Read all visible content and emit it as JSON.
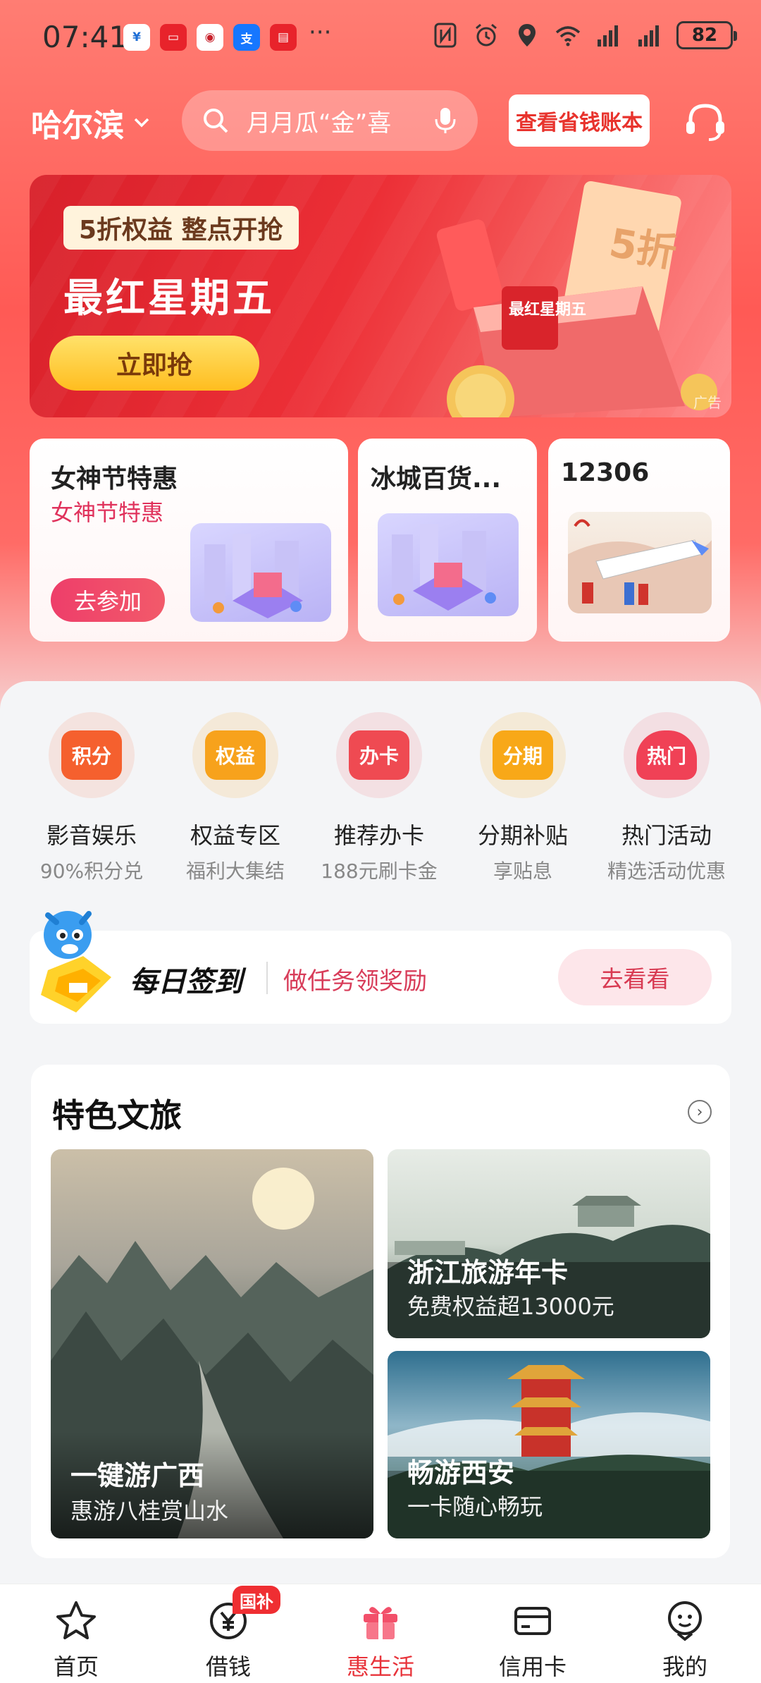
{
  "status_bar": {
    "time": "07:41",
    "battery": "82",
    "more": "···"
  },
  "header": {
    "city": "哈尔滨",
    "search_placeholder": "月月瓜“金”喜",
    "save_button": "查看省钱账本"
  },
  "banner": {
    "tag": "5折权益 整点开抢",
    "title": "最红星期五",
    "button": "立即抢",
    "ad_label": "广告",
    "art_ticket": "5折",
    "art_box": "最红星期五"
  },
  "promos": [
    {
      "title": "女神节特惠",
      "subtitle": "女神节特惠",
      "button": "去参加"
    },
    {
      "title": "冰城百货..."
    },
    {
      "title": "12306"
    }
  ],
  "services": [
    {
      "badge": "积分",
      "label": "影音娱乐",
      "sub": "90%积分兑",
      "color": "#f5602e"
    },
    {
      "badge": "权益",
      "label": "权益专区",
      "sub": "福利大集结",
      "color": "#f7a21c"
    },
    {
      "badge": "办卡",
      "label": "推荐办卡",
      "sub": "188元刷卡金",
      "color": "#ef4a52"
    },
    {
      "badge": "分期",
      "label": "分期补贴",
      "sub": "享贴息",
      "color": "#f8a818"
    },
    {
      "badge": "热门",
      "label": "热门活动",
      "sub": "精选活动优惠",
      "color": "#f04156"
    }
  ],
  "checkin": {
    "title": "每日签到",
    "desc": "做任务领奖励",
    "button": "去看看"
  },
  "travel": {
    "title": "特色文旅",
    "cards": [
      {
        "title": "一键游广西",
        "sub": "惠游八桂赏山水"
      },
      {
        "title": "浙江旅游年卡",
        "sub": "免费权益超13000元"
      },
      {
        "title": "畅游西安",
        "sub": "一卡随心畅玩"
      }
    ]
  },
  "tabbar": {
    "items": [
      {
        "label": "首页"
      },
      {
        "label": "借钱",
        "badge": "国补"
      },
      {
        "label": "惠生活"
      },
      {
        "label": "信用卡"
      },
      {
        "label": "我的"
      }
    ],
    "active_color": "#e8333a"
  }
}
